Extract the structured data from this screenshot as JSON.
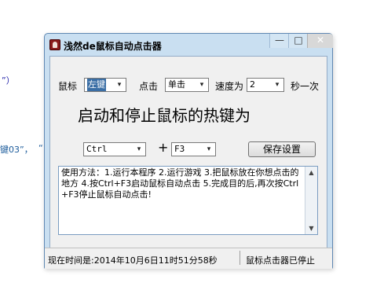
{
  "background": {
    "fragment_1": "”）",
    "fragment_2": "键03”，",
    "fragment_3": "“"
  },
  "window": {
    "title": "浅然de鼠标自动点击器",
    "minimize_glyph": "—",
    "maximize_glyph": "□",
    "close_glyph": "✕"
  },
  "controls": {
    "mouse_label": "鼠标",
    "mouse_value": "左键",
    "click_label": "点击",
    "click_value": "单击",
    "speed_label": "速度为",
    "speed_value": "2",
    "unit_label": "秒一次",
    "hotkey_heading": "启动和停止鼠标的热键为",
    "hotkey_modifier": "Ctrl",
    "plus": "+",
    "hotkey_key": "F3",
    "save_button": "保存设置"
  },
  "instructions": {
    "text": "使用方法：1.运行本程序 2.运行游戏 3.把鼠标放在你想点击的地方 4.按Ctrl+F3启动鼠标自动点击 5.完成目的后,再次按Ctrl+F3停止鼠标自动点击!"
  },
  "status": {
    "time_text": "现在时间是:2014年10月6日11时51分58秒",
    "state_text": "鼠标点击器已停止"
  },
  "icons": {
    "dropdown": "▾",
    "scroll_up": "▲",
    "scroll_down": "▼"
  },
  "colors": {
    "window_border": "#5f88b3",
    "window_frame": "#c9dff1",
    "text_accent": "#1a5a9a",
    "selection": "#3a6ea5"
  }
}
